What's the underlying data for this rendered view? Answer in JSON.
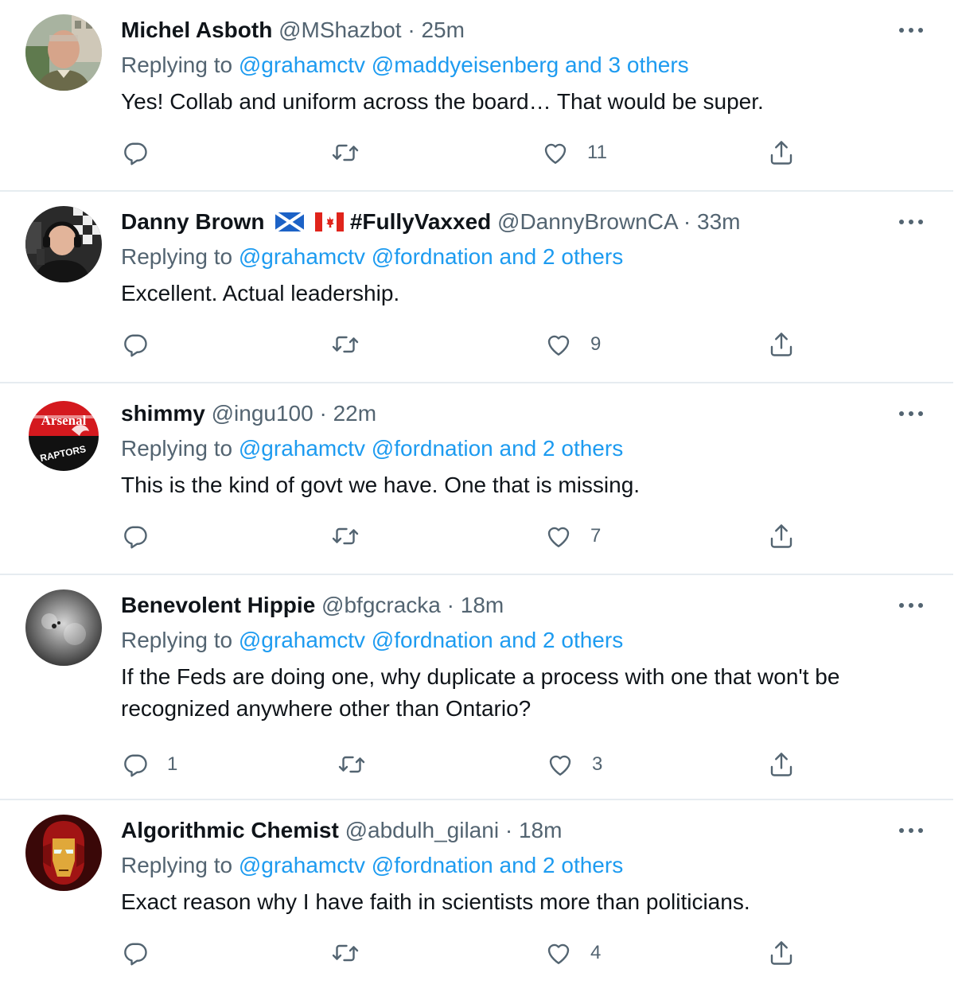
{
  "tweets": [
    {
      "name": "Michel Asboth",
      "handle": "@MShazbot",
      "separator": "·",
      "time": "25m",
      "replying_prefix": "Replying to ",
      "mentions": "@grahamctv @maddyeisenberg and 3 others",
      "text": "Yes! Collab and uniform across the board… That would be super.",
      "reply_count": "",
      "retweet_count": "",
      "like_count": "11"
    },
    {
      "name": "Danny Brown",
      "name_suffix": "#FullyVaxxed",
      "flags": [
        "scotland-flag-icon",
        "canada-flag-icon"
      ],
      "handle": "@DannyBrownCA",
      "separator": "·",
      "time": "33m",
      "replying_prefix": "Replying to ",
      "mentions": "@grahamctv @fordnation and 2 others",
      "text": "Excellent. Actual leadership.",
      "reply_count": "",
      "retweet_count": "",
      "like_count": "9"
    },
    {
      "name": "shimmy",
      "handle": "@ingu100",
      "separator": "·",
      "time": "22m",
      "replying_prefix": "Replying to ",
      "mentions": "@grahamctv @fordnation and 2 others",
      "text": "This is the kind of govt we have. One that is missing.",
      "avatar_text_top": "Arsenal",
      "avatar_text_bottom": "RAPTORS",
      "reply_count": "",
      "retweet_count": "",
      "like_count": "7"
    },
    {
      "name": "Benevolent Hippie",
      "handle": "@bfgcracka",
      "separator": "·",
      "time": "18m",
      "replying_prefix": "Replying to ",
      "mentions": "@grahamctv @fordnation and 2 others",
      "text_line1": "If the Feds are doing one, why duplicate a process with one that won't be",
      "text_line2": "recognized anywhere other than Ontario?",
      "reply_count": "1",
      "retweet_count": "",
      "like_count": "3"
    },
    {
      "name": "Algorithmic Chemist",
      "handle": "@abdulh_gilani",
      "separator": "·",
      "time": "18m",
      "replying_prefix": "Replying to ",
      "mentions": "@grahamctv @fordnation and 2 others",
      "text": "Exact reason why I have faith in scientists more than politicians.",
      "reply_count": "",
      "retweet_count": "",
      "like_count": "4"
    }
  ],
  "colors": {
    "text": "#0f1419",
    "secondary": "#536471",
    "link": "#1d9bf0",
    "divider": "#e6ecf0"
  },
  "icons": [
    "more-icon",
    "reply-icon",
    "retweet-icon",
    "like-icon",
    "share-icon"
  ]
}
